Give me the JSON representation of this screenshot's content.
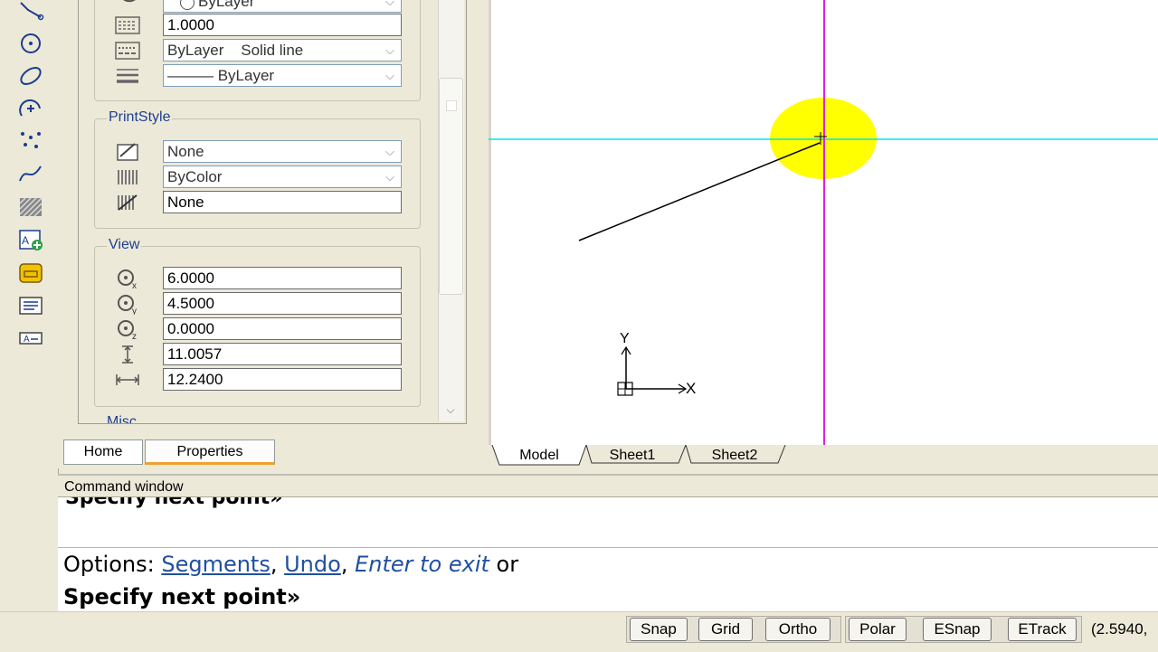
{
  "properties": {
    "general_rows": [
      {
        "value": "ByLayer",
        "type": "combo",
        "icon": "color-icon"
      },
      {
        "value": "1.0000",
        "type": "edit",
        "icon": "linetype-scale-icon"
      },
      {
        "value": "ByLayer    Solid line",
        "type": "combo",
        "icon": "linetype-icon"
      },
      {
        "value": "——— ByLayer",
        "type": "combo",
        "icon": "lineweight-icon"
      }
    ],
    "printstyle": {
      "title": "PrintStyle",
      "rows": [
        {
          "value": "None",
          "type": "combo",
          "icon": "plot-style-icon"
        },
        {
          "value": "ByColor",
          "type": "combo",
          "icon": "plot-style-table-icon"
        },
        {
          "value": "None",
          "type": "edit",
          "icon": "plot-table-attached-icon"
        }
      ]
    },
    "view": {
      "title": "View",
      "rows": [
        {
          "value": "6.0000",
          "icon": "center-x-icon"
        },
        {
          "value": "4.5000",
          "icon": "center-y-icon"
        },
        {
          "value": "0.0000",
          "icon": "center-z-icon"
        },
        {
          "value": "11.0057",
          "icon": "view-height-icon"
        },
        {
          "value": "12.2400",
          "icon": "view-width-icon"
        }
      ]
    },
    "misc_title": "Misc"
  },
  "panel_tabs": {
    "home": "Home",
    "properties": "Properties"
  },
  "layout_tabs": {
    "model": "Model",
    "sheet1": "Sheet1",
    "sheet2": "Sheet2"
  },
  "drawing": {
    "ucs_x_label": "X",
    "ucs_y_label": "Y",
    "crosshair_h_color": "#00e5ee",
    "crosshair_v_color": "#e020e0",
    "highlight_color": "#ffff00"
  },
  "command": {
    "title": "Command window",
    "history": "Specify next point»",
    "options_prefix": "Options: ",
    "opt_segments": "Segments",
    "opt_undo": "Undo",
    "opt_enter": "Enter to exit",
    "options_suffix": " or",
    "prompt": "Specify next point»"
  },
  "status": {
    "snap": "Snap",
    "grid": "Grid",
    "ortho": "Ortho",
    "polar": "Polar",
    "esnap": "ESnap",
    "etrack": "ETrack",
    "coords": "(2.5940,"
  },
  "toolbar_icons": [
    "polyline-icon",
    "circle-icon",
    "ellipse-icon",
    "arc-icon",
    "point-icon",
    "spline-icon",
    "hatch-icon",
    "insert-block-icon",
    "region-icon",
    "mtext-icon",
    "text-icon"
  ]
}
